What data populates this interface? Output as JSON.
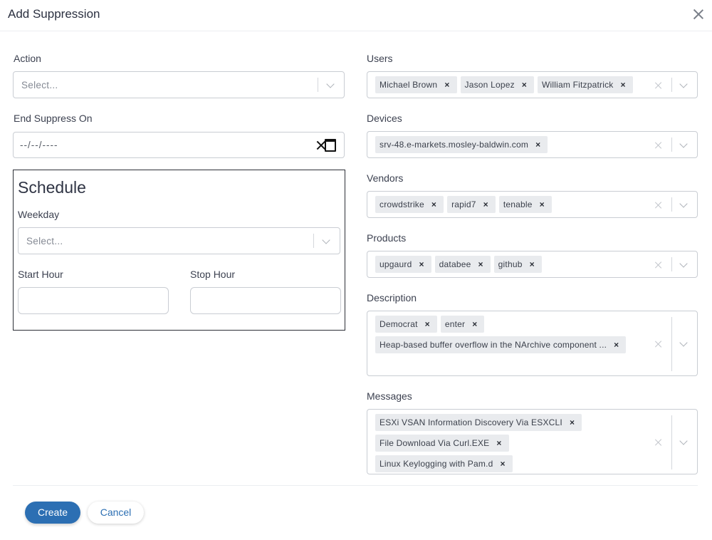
{
  "dialog": {
    "title": "Add Suppression"
  },
  "left": {
    "action": {
      "label": "Action",
      "placeholder": "Select..."
    },
    "end_suppress": {
      "label": "End Suppress On",
      "value": "--/--/----"
    },
    "schedule": {
      "title": "Schedule",
      "weekday": {
        "label": "Weekday",
        "placeholder": "Select..."
      },
      "start_hour": {
        "label": "Start Hour",
        "value": ""
      },
      "stop_hour": {
        "label": "Stop Hour",
        "value": ""
      }
    }
  },
  "right": {
    "users": {
      "label": "Users",
      "tags": [
        "Michael Brown",
        "Jason Lopez",
        "William Fitzpatrick"
      ]
    },
    "devices": {
      "label": "Devices",
      "tags": [
        "srv-48.e-markets.mosley-baldwin.com"
      ]
    },
    "vendors": {
      "label": "Vendors",
      "tags": [
        "crowdstrike",
        "rapid7",
        "tenable"
      ]
    },
    "products": {
      "label": "Products",
      "tags": [
        "upgaurd",
        "databee",
        "github"
      ]
    },
    "description": {
      "label": "Description",
      "tags": [
        "Democrat",
        "enter",
        "Heap-based buffer overflow in the NArchive component ..."
      ]
    },
    "messages": {
      "label": "Messages",
      "tags": [
        "ESXi VSAN Information Discovery Via ESXCLI",
        "File Download Via Curl.EXE",
        "Linux Keylogging with Pam.d"
      ]
    }
  },
  "footer": {
    "create_label": "Create",
    "cancel_label": "Cancel"
  },
  "tag_remove_glyph": "×"
}
